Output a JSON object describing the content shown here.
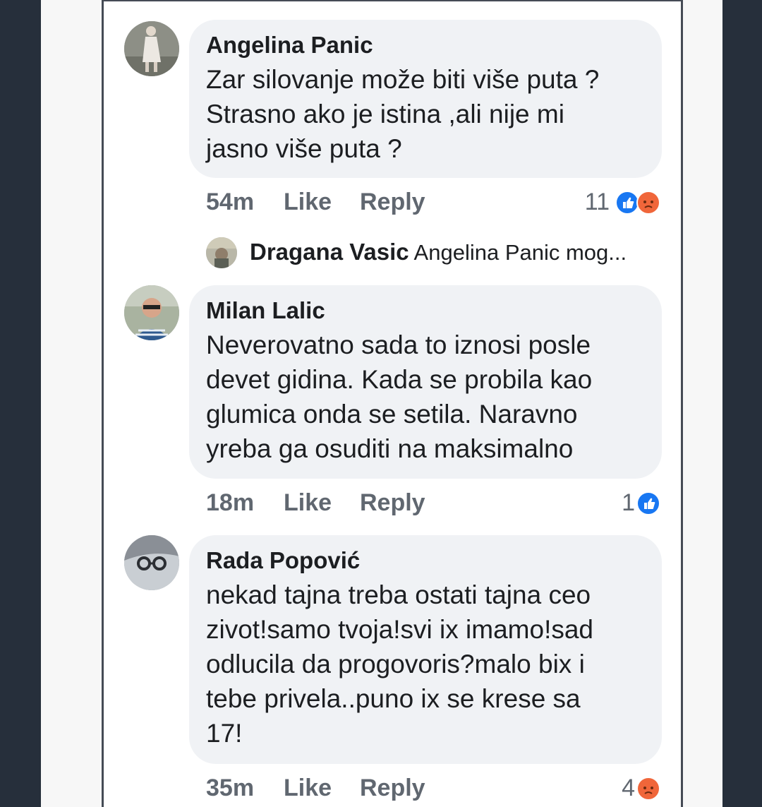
{
  "comments": [
    {
      "name": "Angelina Panic",
      "lines": [
        "Zar silovanje može biti više puta ?",
        "Strasno ako je istina ,ali nije mi",
        "jasno više puta ?"
      ],
      "time": "54m",
      "like": "Like",
      "reply": "Reply",
      "reaction_count": "11",
      "reactions": [
        "like-icon",
        "angry-icon"
      ]
    },
    {
      "name": "Milan Lalic",
      "lines": [
        "Neverovatno sada to iznosi posle",
        "devet gidina. Kada se probila kao",
        "glumica onda se setila. Naravno",
        "yreba ga osuditi na maksimalno"
      ],
      "time": "18m",
      "like": "Like",
      "reply": "Reply",
      "reaction_count": "1",
      "reactions": [
        "like-icon"
      ]
    },
    {
      "name": "Rada Popović",
      "lines": [
        "nekad tajna treba ostati tajna ceo",
        "zivot!samo tvoja!svi ix imamo!sad",
        "odlucila da progovoris?malo bix i",
        "tebe privela..puno ix se krese sa",
        "17!"
      ],
      "time": "35m",
      "like": "Like",
      "reply": "Reply",
      "reaction_count": "4",
      "reactions": [
        "angry-icon"
      ]
    }
  ],
  "reply_preview": {
    "name": "Dragana Vasic",
    "text": "Angelina Panic  mog..."
  },
  "colors": {
    "bubble": "#f0f2f5",
    "meta_text": "#606770",
    "like_blue": "#1877f2",
    "angry_orange": "#f0663a",
    "outer_bg": "#262f3b"
  }
}
